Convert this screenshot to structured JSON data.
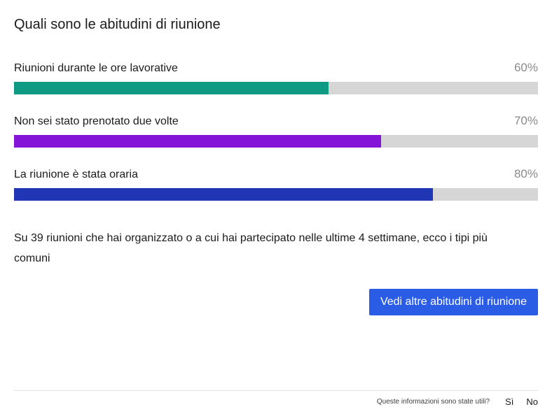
{
  "title": "Quali sono le abitudini di riunione",
  "bars": [
    {
      "label": "Riunioni durante le ore lavorative",
      "value": 60,
      "display": "60%",
      "color": "#0f9b83"
    },
    {
      "label": "Non sei stato prenotato due volte",
      "value": 70,
      "display": "70%",
      "color": "#8314d8"
    },
    {
      "label": "La riunione è stata oraria",
      "value": 80,
      "display": "80%",
      "color": "#2136b4"
    }
  ],
  "summary": "Su 39 riunioni che hai organizzato o a cui hai partecipato nelle ultime 4 settimane, ecco i tipi più comuni",
  "cta": "Vedi altre abitudini di riunione",
  "feedback": {
    "prompt": "Queste informazioni sono state utili?",
    "yes": "Sì",
    "no": "No"
  },
  "chart_data": {
    "type": "bar",
    "categories": [
      "Riunioni durante le ore lavorative",
      "Non sei stato prenotato due volte",
      "La riunione è stata oraria"
    ],
    "values": [
      60,
      70,
      80
    ],
    "title": "Quali sono le abitudini di riunione",
    "xlabel": "",
    "ylabel": "%",
    "ylim": [
      0,
      100
    ]
  }
}
